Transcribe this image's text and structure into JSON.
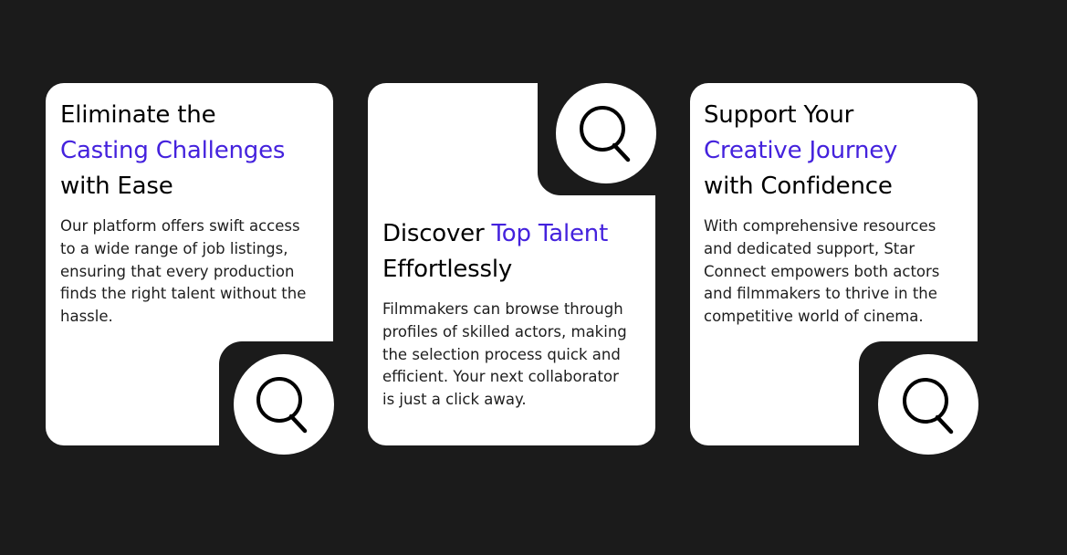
{
  "colors": {
    "background": "#1b1b1b",
    "card": "#ffffff",
    "heading": "#000000",
    "accent": "#4422dd",
    "body_text": "#1e1e1e"
  },
  "cards": [
    {
      "title_line1": "Eliminate the",
      "title_accent": "Casting Challenges",
      "title_line3": "with Ease",
      "body_line1": "Our platform offers swift access",
      "body_line2": "to a wide range of job listings,",
      "body_line3": "ensuring that every production",
      "body_line4": "finds the right talent without the",
      "body_line5": "hassle.",
      "icon": "search-icon"
    },
    {
      "title_prefix": "Discover ",
      "title_accent": "Top Talent",
      "title_line2": "Effortlessly",
      "body_line1": "Filmmakers can browse through",
      "body_line2": "profiles of skilled actors, making",
      "body_line3": "the selection process quick and",
      "body_line4": "efficient. Your next collaborator",
      "body_line5": "is just a click away.",
      "icon": "search-icon"
    },
    {
      "title_line1": "Support Your",
      "title_accent": "Creative Journey",
      "title_line3": "with Confidence",
      "body_line1": "With comprehensive resources",
      "body_line2": "and dedicated support, Star",
      "body_line3": "Connect empowers both actors",
      "body_line4": "and filmmakers to thrive in the",
      "body_line5": "competitive world of cinema.",
      "icon": "search-icon"
    }
  ]
}
